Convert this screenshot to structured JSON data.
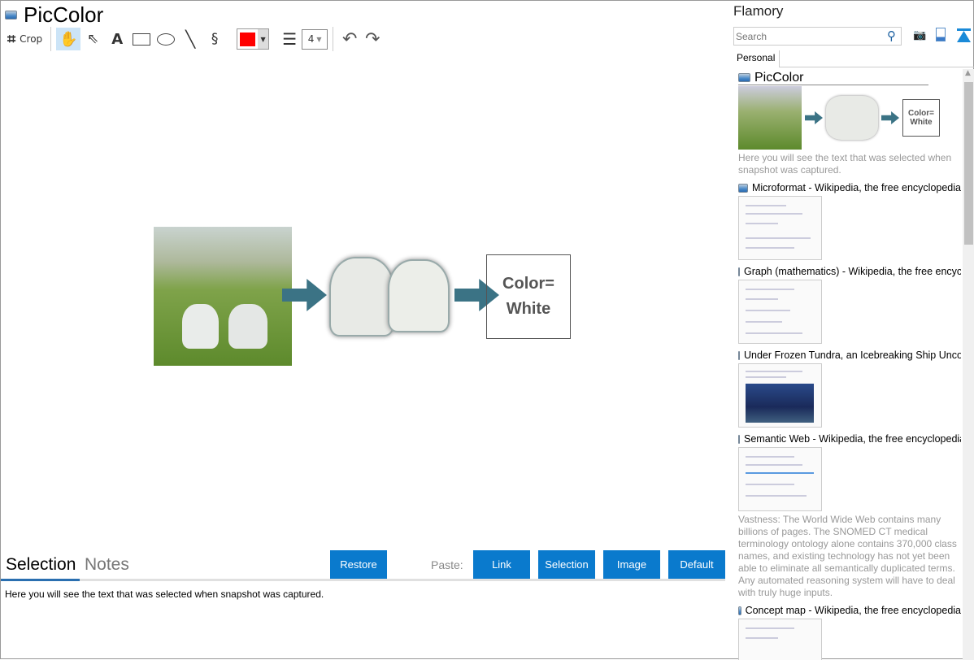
{
  "app": {
    "title": "PicColor"
  },
  "toolbar": {
    "crop_label": "Crop",
    "line_width": "4",
    "color": "#ff0000",
    "tools": [
      "hand-icon",
      "pointer-icon",
      "text-icon",
      "rectangle-icon",
      "ellipse-icon",
      "line-icon",
      "freehand-icon"
    ]
  },
  "canvas": {
    "box_text_line1": "Color=",
    "box_text_line2": "White"
  },
  "tabs": {
    "selection": "Selection",
    "notes": "Notes"
  },
  "buttons": {
    "restore": "Restore",
    "paste_label": "Paste:",
    "link": "Link",
    "selection": "Selection",
    "image": "Image",
    "default": "Default"
  },
  "selection_text": "Here you will see the text that was selected when snapshot was captured.",
  "sidebar": {
    "title": "Flamory",
    "search_placeholder": "Search",
    "tab": "Personal",
    "items": [
      {
        "title": "PicColor",
        "desc": "Here you will see the text that was selected when snapshot was captured."
      },
      {
        "title": "Microformat - Wikipedia, the free encyclopedia",
        "desc": ""
      },
      {
        "title": "Graph (mathematics) - Wikipedia, the free encyclopedia",
        "desc": ""
      },
      {
        "title": "Under Frozen Tundra, an Icebreaking Ship Uncovers",
        "desc": ""
      },
      {
        "title": "Semantic Web - Wikipedia, the free encyclopedia",
        "desc": "Vastness: The World Wide Web contains many billions of pages. The SNOMED CT medical terminology ontology alone contains 370,000 class names, and existing technology has not yet been able to eliminate all semantically duplicated terms. Any automated reasoning system will have to deal with truly huge inputs."
      },
      {
        "title": "Concept map - Wikipedia, the free encyclopedia",
        "desc": ""
      }
    ]
  },
  "colors": {
    "accent": "#0a7acd",
    "arrow": "#3b7385"
  }
}
